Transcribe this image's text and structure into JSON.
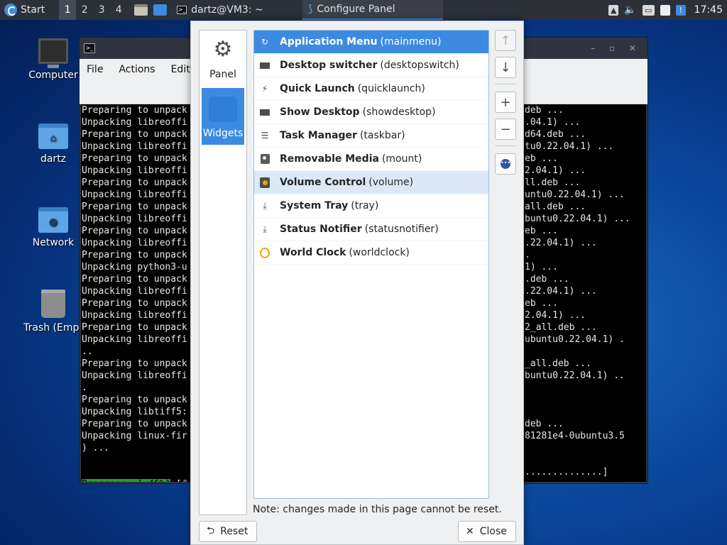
{
  "panel": {
    "start_label": "Start",
    "workspaces": [
      "1",
      "2",
      "3",
      "4"
    ],
    "tasks": {
      "terminal": "dartz@VM3: ~",
      "configure": "Configure Panel"
    },
    "clock": "17:45"
  },
  "desktop": {
    "icons": [
      {
        "label": "Computer",
        "icon": "computer-icon"
      },
      {
        "label": "dartz",
        "icon": "home-folder-icon"
      },
      {
        "label": "Network",
        "icon": "network-folder-icon"
      },
      {
        "label": "Trash (Empt",
        "icon": "trash-icon"
      }
    ]
  },
  "terminal": {
    "menu": [
      "File",
      "Actions",
      "Edit"
    ],
    "left_lines": [
      "Preparing to unpack",
      "Unpacking libreoffi",
      "Preparing to unpack",
      "Unpacking libreoffi",
      "Preparing to unpack",
      "Unpacking libreoffi",
      "Preparing to unpack",
      "Unpacking libreoffi",
      "Preparing to unpack",
      "Unpacking libreoffi",
      "Preparing to unpack",
      "Unpacking libreoffi",
      "Preparing to unpack",
      "Unpacking python3-u",
      "Preparing to unpack",
      "Unpacking libreoffi",
      "Preparing to unpack",
      "Unpacking libreoffi",
      "Preparing to unpack",
      "Unpacking libreoffi",
      "..",
      "Preparing to unpack",
      "Unpacking libreoffi",
      ".",
      "Preparing to unpack",
      "Unpacking libtiff5:",
      "Preparing to unpack",
      "Unpacking linux-fir",
      ") ...",
      "",
      ""
    ],
    "right_lines": [
      "deb ...",
      ".04.1) ...",
      "d64.deb ...",
      "tu0.22.04.1) ...",
      "eb ...",
      "2.04.1) ...",
      "ll.deb ...",
      "untu0.22.04.1) ...",
      "all.deb ...",
      "buntu0.22.04.1) ...",
      "eb ...",
      ".22.04.1) ...",
      ".",
      "1) ...",
      ".deb ...",
      ".22.04.1) ...",
      "eb ...",
      "2.04.1) ...",
      "2_all.deb ...",
      "ubuntu0.22.04.1) .",
      "",
      "_all.deb ...",
      "buntu0.22.04.1) ..",
      "",
      "",
      "",
      "deb ...",
      "81281e4-0ubuntu3.5",
      "",
      "",
      "..............]"
    ],
    "progress_label": "Progress: [ 46%]",
    "progress_tail": " [#",
    "progress_percent": 46
  },
  "dialog": {
    "categories": [
      {
        "label": "Panel",
        "icon": "gear-icon"
      },
      {
        "label": "Widgets",
        "icon": "puzzle-icon"
      }
    ],
    "widgets": [
      {
        "name": "Application Menu",
        "id": "(mainmenu)",
        "icon": "app-menu-icon"
      },
      {
        "name": "Desktop switcher",
        "id": "(desktopswitch)",
        "icon": "desktop-switcher-icon"
      },
      {
        "name": "Quick Launch",
        "id": "(quicklaunch)",
        "icon": "quick-launch-icon"
      },
      {
        "name": "Show Desktop",
        "id": "(showdesktop)",
        "icon": "show-desktop-icon"
      },
      {
        "name": "Task Manager",
        "id": "(taskbar)",
        "icon": "task-manager-icon"
      },
      {
        "name": "Removable Media",
        "id": "(mount)",
        "icon": "removable-media-icon"
      },
      {
        "name": "Volume Control",
        "id": "(volume)",
        "icon": "volume-control-icon"
      },
      {
        "name": "System Tray",
        "id": "(tray)",
        "icon": "system-tray-icon"
      },
      {
        "name": "Status Notifier",
        "id": "(statusnotifier)",
        "icon": "status-notifier-icon"
      },
      {
        "name": "World Clock",
        "id": "(worldclock)",
        "icon": "world-clock-icon"
      }
    ],
    "note": "Note: changes made in this page cannot be reset.",
    "reset_label": "Reset",
    "close_label": "Close"
  }
}
